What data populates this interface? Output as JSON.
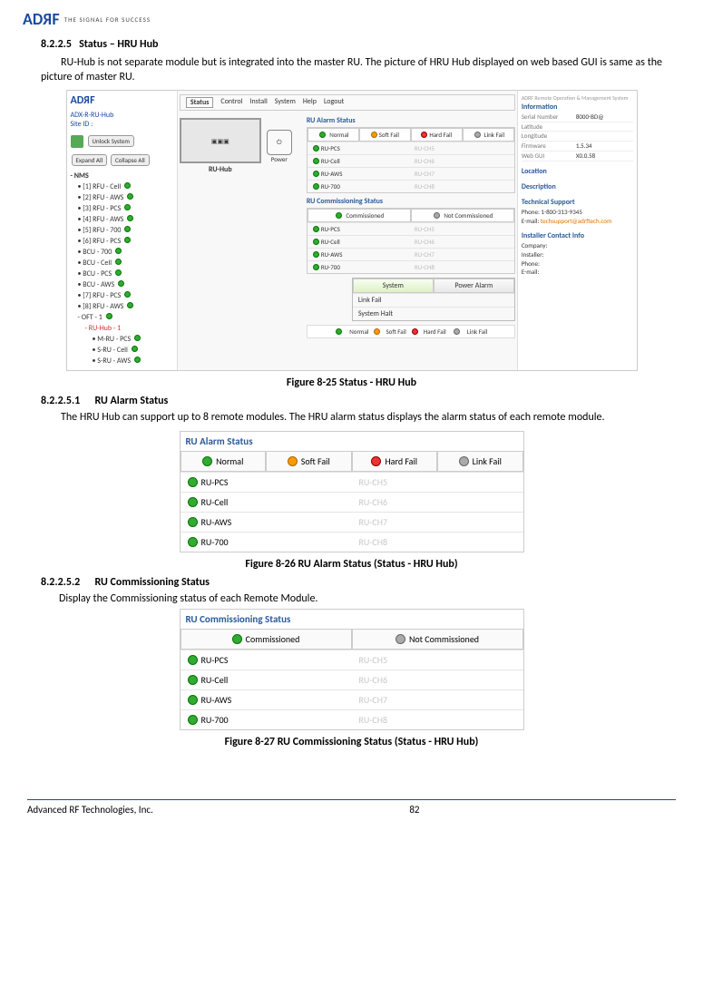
{
  "logo": {
    "pre": "AD",
    "suf": "F",
    "sub": "THE SIGNAL FOR SUCCESS"
  },
  "s": {
    "h1_num": "8.2.2.5",
    "h1_title": "Status – HRU Hub",
    "p1": "RU-Hub is not separate module but is integrated into the master RU.  The picture of HRU Hub displayed on web based GUI is same as the picture of master RU.",
    "fig25": "Figure 8-25   Status - HRU Hub",
    "h2_num": "8.2.2.5.1",
    "h2_title": "RU Alarm Status",
    "p2": "The HRU Hub can support up to 8 remote modules. The HRU alarm status displays the alarm status of each remote module.",
    "fig26": "Figure 8-26   RU Alarm Status (Status - HRU Hub)",
    "h3_num": "8.2.2.5.2",
    "h3_title": "RU Commissioning Status",
    "p3": "Display the Commissioning status of each Remote Module.",
    "fig27": "Figure 8-27   RU Commissioning Status (Status - HRU Hub)"
  },
  "big": {
    "site_title": "ADX-R-RU-Hub",
    "site_id": "Site ID :",
    "menu": [
      "Status",
      "Control",
      "Install",
      "System",
      "Help",
      "Logout"
    ],
    "expand": "Expand All",
    "collapse": "Collapse All",
    "unlock": "Unlock System",
    "hub_label": "RU-Hub",
    "power": "Power",
    "tree_hdr": "NMS",
    "tree": [
      "[1] RFU - Cell",
      "[2] RFU - AWS",
      "[3] RFU - PCS",
      "[4] RFU - AWS",
      "[5] RFU - 700",
      "[6] RFU - PCS",
      "BCU - 700",
      "BCU - Cell",
      "BCU - PCS",
      "BCU - AWS",
      "[7] RFU - PCS",
      "[8] RFU - AWS",
      "OFT - 1"
    ],
    "tree_sel": "RU-Hub - 1",
    "tree_sub": [
      "M-RU - PCS",
      "S-RU - Cell",
      "S-RU - AWS"
    ],
    "alarm_title": "RU Alarm Status",
    "chips_alarm": [
      "Normal",
      "Soft Fail",
      "Hard Fail",
      "Link Fail"
    ],
    "alarm_left": [
      "RU-PCS",
      "RU-Cell",
      "RU-AWS",
      "RU-700"
    ],
    "alarm_right": [
      "RU-CH5",
      "RU-CH6",
      "RU-CH7",
      "RU-CH8"
    ],
    "comm_title": "RU Commissioning Status",
    "chips_comm": [
      "Commissioned",
      "Not Commissioned"
    ],
    "sys": "System",
    "pa": "Power Alarm",
    "lf": "Link Fail",
    "sh": "System Halt",
    "legend": [
      "Normal",
      "Soft Fail",
      "Hard Fail",
      "Link Fail"
    ],
    "info_brand": "ADRF Remote Operation & Management System",
    "info_hdr": "Information",
    "info": [
      [
        "Serial Number",
        "8000-BD@"
      ],
      [
        "Latitude",
        ""
      ],
      [
        "Longitude",
        ""
      ],
      [
        "Firmware",
        "1.5.34"
      ],
      [
        "Web GUI",
        "X0.0.58"
      ]
    ],
    "loc": "Location",
    "desc": "Description",
    "tech": "Technical Support",
    "phone": "Phone: 1-800-313-9345",
    "email_pre": "E-mail: ",
    "email": "techsupport@adrftech.com",
    "inst": "Installer Contact Info",
    "inst_rows": [
      "Company:",
      "Installer:",
      "Phone:",
      "E-mail:"
    ]
  },
  "t26": {
    "title": "RU Alarm Status",
    "chips": [
      "Normal",
      "Soft Fail",
      "Hard Fail",
      "Link Fail"
    ],
    "left": [
      "RU-PCS",
      "RU-Cell",
      "RU-AWS",
      "RU-700"
    ],
    "right": [
      "RU-CH5",
      "RU-CH6",
      "RU-CH7",
      "RU-CH8"
    ]
  },
  "t27": {
    "title": "RU Commissioning Status",
    "chips": [
      "Commissioned",
      "Not Commissioned"
    ],
    "left": [
      "RU-PCS",
      "RU-Cell",
      "RU-AWS",
      "RU-700"
    ],
    "right": [
      "RU-CH5",
      "RU-CH6",
      "RU-CH7",
      "RU-CH8"
    ]
  },
  "footer": {
    "company": "Advanced RF Technologies, Inc.",
    "page": "82"
  }
}
